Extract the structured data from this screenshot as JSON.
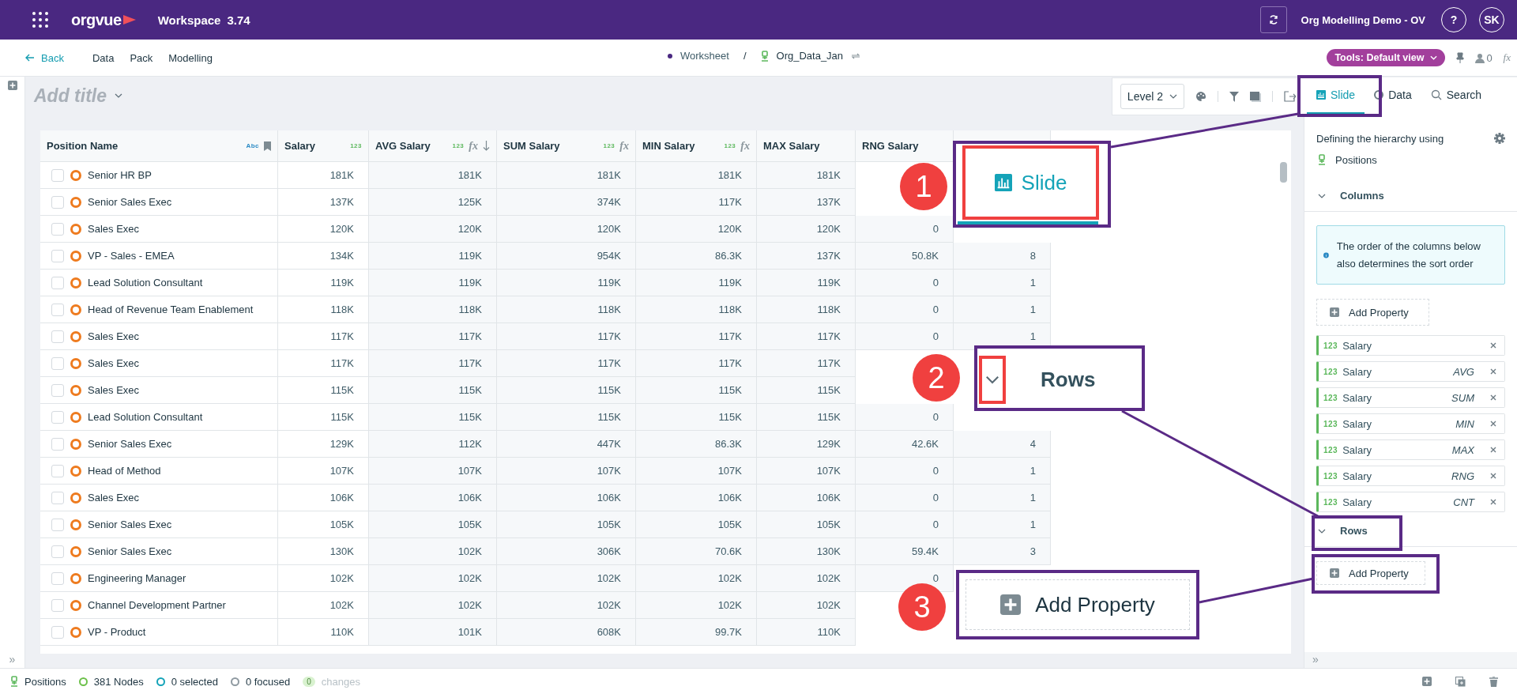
{
  "top_bar": {
    "logo": "orgvue",
    "app": "Workspace",
    "version": "3.74",
    "dataset": "Org Modelling Demo - OV",
    "help": "?",
    "avatar": "SK"
  },
  "nav": {
    "back": "Back",
    "menu": [
      "Data",
      "Pack",
      "Modelling"
    ],
    "breadcrumb": [
      "Worksheet",
      "Org_Data_Jan"
    ],
    "separator": "/",
    "tools": "Tools: Default view",
    "count": "0",
    "fx": "fx"
  },
  "title": {
    "placeholder": "Add title"
  },
  "toolbar": {
    "level": "Level 2"
  },
  "tabs": [
    {
      "label": "Slide",
      "selected": true
    },
    {
      "label": "Data",
      "selected": false
    },
    {
      "label": "Search",
      "selected": false
    }
  ],
  "table": {
    "columns": [
      {
        "label": "Position Name",
        "type": "Abc",
        "bookmark": true
      },
      {
        "label": "Salary",
        "type": "123"
      },
      {
        "label": "AVG Salary",
        "type": "123",
        "fx": "fx",
        "sorted": true
      },
      {
        "label": "SUM Salary",
        "type": "123",
        "fx": "fx"
      },
      {
        "label": "MIN Salary",
        "type": "123",
        "fx": "fx"
      },
      {
        "label": "MAX Salary"
      },
      {
        "label": "RNG Salary"
      },
      {}
    ],
    "rows": [
      {
        "checked": false,
        "cells": [
          "Senior HR BP",
          "181K",
          "181K",
          "181K",
          "181K",
          "181K",
          null,
          null
        ]
      },
      {
        "checked": false,
        "cells": [
          "Senior Sales Exec",
          "137K",
          "125K",
          "374K",
          "117K",
          "137K",
          null,
          null
        ]
      },
      {
        "checked": false,
        "cells": [
          "Sales Exec",
          "120K",
          "120K",
          "120K",
          "120K",
          "120K",
          "0",
          null
        ]
      },
      {
        "checked": false,
        "cells": [
          "VP - Sales - EMEA",
          "134K",
          "119K",
          "954K",
          "86.3K",
          "137K",
          "50.8K",
          "8"
        ]
      },
      {
        "checked": false,
        "cells": [
          "Lead Solution Consultant",
          "119K",
          "119K",
          "119K",
          "119K",
          "119K",
          "0",
          "1"
        ]
      },
      {
        "checked": false,
        "cells": [
          "Head of Revenue Team Enablement",
          "118K",
          "118K",
          "118K",
          "118K",
          "118K",
          "0",
          "1"
        ]
      },
      {
        "checked": false,
        "cells": [
          "Sales Exec",
          "117K",
          "117K",
          "117K",
          "117K",
          "117K",
          "0",
          "1"
        ]
      },
      {
        "checked": false,
        "cells": [
          "Sales Exec",
          "117K",
          "117K",
          "117K",
          "117K",
          "117K",
          null,
          null
        ]
      },
      {
        "checked": false,
        "cells": [
          "Sales Exec",
          "115K",
          "115K",
          "115K",
          "115K",
          "115K",
          null,
          null
        ]
      },
      {
        "checked": false,
        "cells": [
          "Lead Solution Consultant",
          "115K",
          "115K",
          "115K",
          "115K",
          "115K",
          "0",
          null
        ]
      },
      {
        "checked": false,
        "cells": [
          "Senior Sales Exec",
          "129K",
          "112K",
          "447K",
          "86.3K",
          "129K",
          "42.6K",
          "4"
        ]
      },
      {
        "checked": false,
        "cells": [
          "Head of Method",
          "107K",
          "107K",
          "107K",
          "107K",
          "107K",
          "0",
          "1"
        ]
      },
      {
        "checked": false,
        "cells": [
          "Sales Exec",
          "106K",
          "106K",
          "106K",
          "106K",
          "106K",
          "0",
          "1"
        ]
      },
      {
        "checked": false,
        "cells": [
          "Senior Sales Exec",
          "105K",
          "105K",
          "105K",
          "105K",
          "105K",
          "0",
          "1"
        ]
      },
      {
        "checked": false,
        "cells": [
          "Senior Sales Exec",
          "130K",
          "102K",
          "306K",
          "70.6K",
          "130K",
          "59.4K",
          "3"
        ]
      },
      {
        "checked": false,
        "cells": [
          "Engineering Manager",
          "102K",
          "102K",
          "102K",
          "102K",
          "102K",
          "0",
          null
        ]
      },
      {
        "checked": false,
        "cells": [
          "Channel Development Partner",
          "102K",
          "102K",
          "102K",
          "102K",
          "102K",
          null,
          null
        ]
      },
      {
        "checked": false,
        "cells": [
          "VP - Product",
          "110K",
          "101K",
          "608K",
          "99.7K",
          "110K",
          null,
          null
        ]
      }
    ]
  },
  "gutter": {
    "expand": "»"
  },
  "side_panel": {
    "expand": "»",
    "hierarchy_label": "Defining the hierarchy using",
    "hierarchy": "Positions",
    "sections": [
      {
        "title": "Columns",
        "expanded": true,
        "info": "The order of the columns below also determines the sort order",
        "add_label": "Add Property",
        "items": [
          {
            "type": "123",
            "name": "Salary"
          },
          {
            "type": "123",
            "name": "Salary",
            "aggregate": "AVG"
          },
          {
            "type": "123",
            "name": "Salary",
            "aggregate": "SUM"
          },
          {
            "type": "123",
            "name": "Salary",
            "aggregate": "MIN"
          },
          {
            "type": "123",
            "name": "Salary",
            "aggregate": "MAX"
          },
          {
            "type": "123",
            "name": "Salary",
            "aggregate": "RNG"
          },
          {
            "type": "123",
            "name": "Salary",
            "aggregate": "CNT"
          }
        ]
      },
      {
        "title": "Rows",
        "expanded": true,
        "add_label": "Add Property"
      }
    ]
  },
  "status_bar": [
    {
      "kind": "positions",
      "label": "Positions"
    },
    {
      "kind": "nodes",
      "label": "381 Nodes"
    },
    {
      "kind": "selected",
      "label": "0 selected"
    },
    {
      "kind": "focused",
      "label": "0 focused"
    },
    {
      "kind": "changes",
      "badge": "0",
      "label": "changes",
      "disabled": true
    }
  ],
  "callouts": [
    {
      "number": "1",
      "kind": "tab",
      "label": "Slide"
    },
    {
      "number": "2",
      "kind": "section",
      "label": "Rows"
    },
    {
      "number": "3",
      "kind": "add",
      "label": "Add Property"
    }
  ]
}
